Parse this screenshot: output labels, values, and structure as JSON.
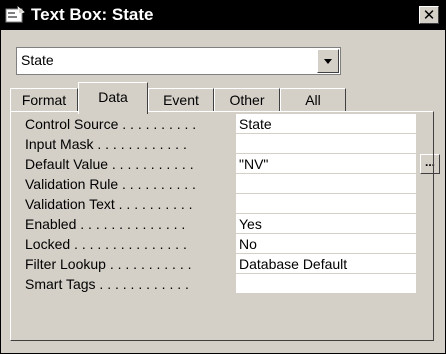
{
  "window": {
    "title": "Text Box: State",
    "close_symbol": "✕",
    "title_icon": "properties-icon"
  },
  "object_selector": {
    "value": "State"
  },
  "tabs": [
    {
      "label": "Format"
    },
    {
      "label": "Data",
      "active": true
    },
    {
      "label": "Event"
    },
    {
      "label": "Other"
    },
    {
      "label": "All"
    }
  ],
  "properties": [
    {
      "label": "Control Source . . . . . . . . . .",
      "value": "State"
    },
    {
      "label": "Input Mask . . . . . . . . . . . .",
      "value": ""
    },
    {
      "label": "Default Value . . . . . . . . . . .",
      "value": "\"NV\""
    },
    {
      "label": "Validation Rule . . . . . . . . . .",
      "value": ""
    },
    {
      "label": "Validation Text . . . . . . . . . .",
      "value": ""
    },
    {
      "label": "Enabled . . . . . . . . . . . . . .",
      "value": "Yes"
    },
    {
      "label": "Locked . . . . . . . . . . . . . . .",
      "value": "No"
    },
    {
      "label": "Filter Lookup . . . . . . . . . . .",
      "value": "Database Default"
    },
    {
      "label": "Smart Tags . . . . . . . . . . . .",
      "value": ""
    }
  ],
  "build_button_label": "..."
}
